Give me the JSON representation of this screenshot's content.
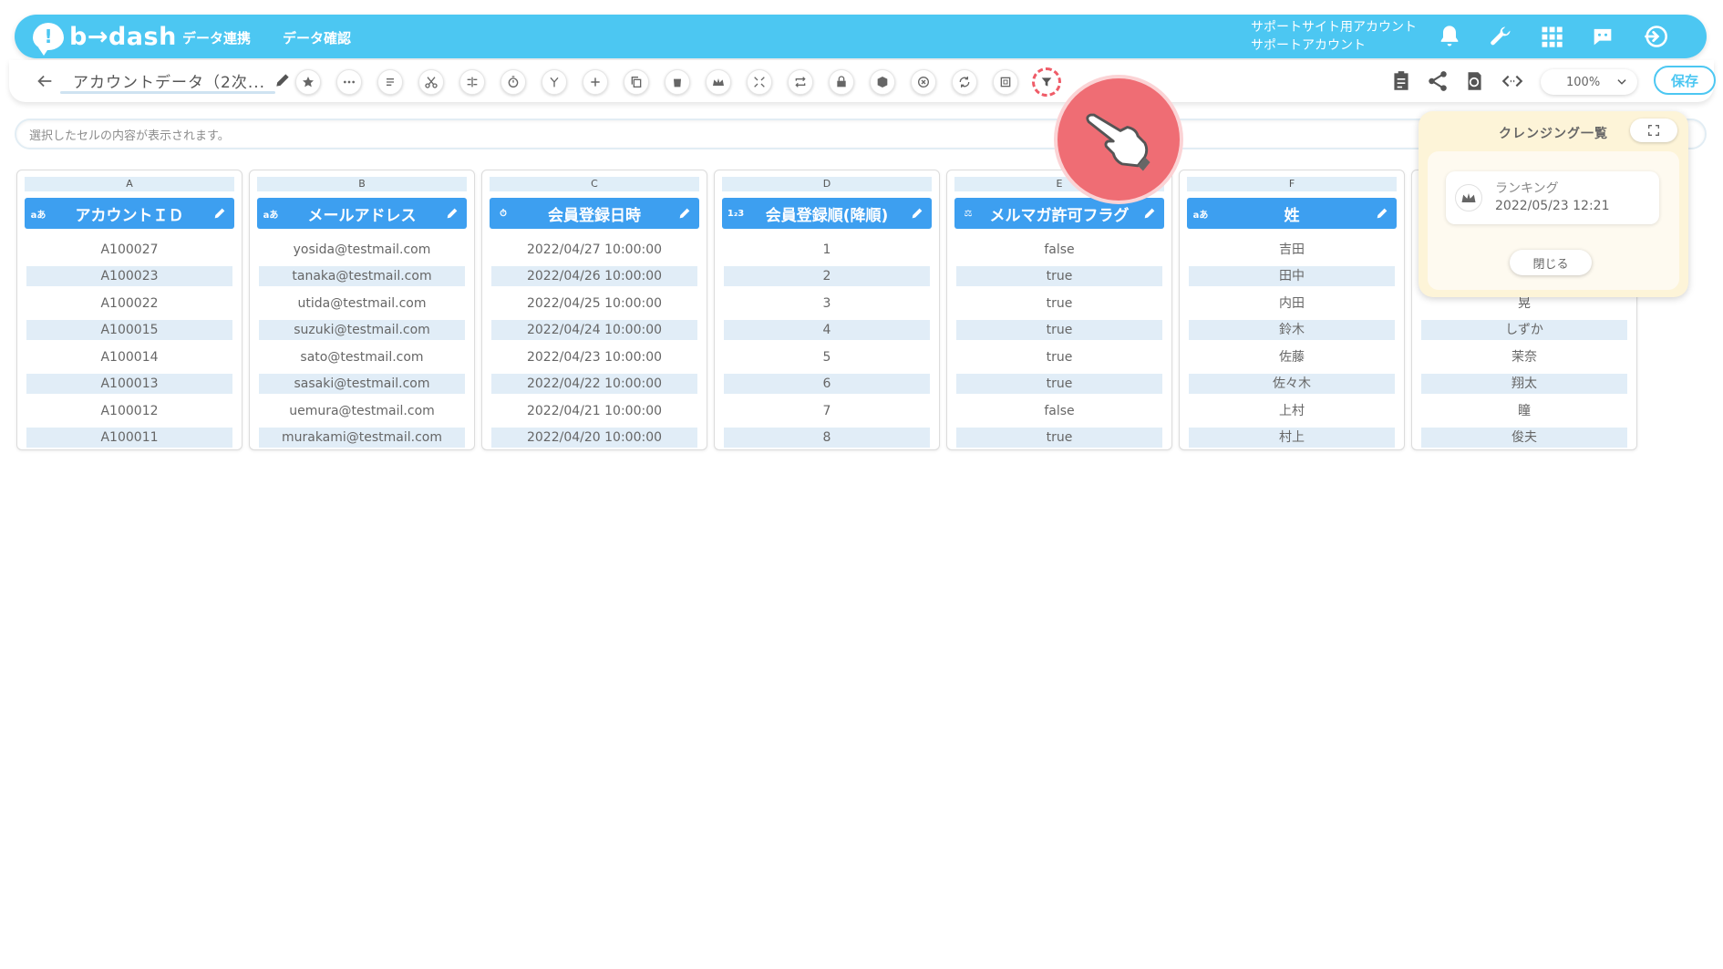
{
  "header": {
    "logo_text": "b→dash",
    "nav": [
      "データ連携",
      "データ確認"
    ],
    "account_line1": "サポートサイト用アカウント",
    "account_line2": "サポートアカウント"
  },
  "toolbar": {
    "title": "アカウントデータ（2次...",
    "zoom": "100%",
    "save_label": "保存",
    "tools": [
      "star-icon",
      "more-icon",
      "list-icon",
      "scissors-icon",
      "split-icon",
      "timer-icon",
      "branch-icon",
      "plus-icon",
      "copy-icon",
      "trash-icon",
      "crown-icon",
      "compress-icon",
      "repeat-icon",
      "lock-icon",
      "cube-icon",
      "close-circle-icon",
      "refresh-icon",
      "frame-icon",
      "filter-icon"
    ]
  },
  "formula_bar": {
    "placeholder": "選択したセルの内容が表示されます。"
  },
  "grid": {
    "columns": [
      {
        "letter": "A",
        "name": "アカウントＩＤ",
        "type": "text",
        "cells": [
          "A100027",
          "A100023",
          "A100022",
          "A100015",
          "A100014",
          "A100013",
          "A100012",
          "A100011"
        ]
      },
      {
        "letter": "B",
        "name": "メールアドレス",
        "type": "text",
        "cells": [
          "yosida@testmail.com",
          "tanaka@testmail.com",
          "utida@testmail.com",
          "suzuki@testmail.com",
          "sato@testmail.com",
          "sasaki@testmail.com",
          "uemura@testmail.com",
          "murakami@testmail.com"
        ]
      },
      {
        "letter": "C",
        "name": "会員登録日時",
        "type": "datetime",
        "cells": [
          "2022/04/27 10:00:00",
          "2022/04/26 10:00:00",
          "2022/04/25 10:00:00",
          "2022/04/24 10:00:00",
          "2022/04/23 10:00:00",
          "2022/04/22 10:00:00",
          "2022/04/21 10:00:00",
          "2022/04/20 10:00:00"
        ]
      },
      {
        "letter": "D",
        "name": "会員登録順(降順)",
        "type": "number",
        "cells": [
          "1",
          "2",
          "3",
          "4",
          "5",
          "6",
          "7",
          "8"
        ]
      },
      {
        "letter": "E",
        "name": "メルマガ許可フラグ",
        "type": "boolean",
        "cells": [
          "false",
          "true",
          "true",
          "true",
          "true",
          "true",
          "false",
          "true"
        ]
      },
      {
        "letter": "F",
        "name": "姓",
        "type": "text",
        "cells": [
          "吉田",
          "田中",
          "内田",
          "鈴木",
          "佐藤",
          "佐々木",
          "上村",
          "村上"
        ]
      },
      {
        "letter": "",
        "name": "",
        "type": "text",
        "cells": [
          "",
          "",
          "晃",
          "しずか",
          "茉奈",
          "翔太",
          "瞳",
          "俊夫"
        ]
      }
    ]
  },
  "cleansing_panel": {
    "title": "クレンジング一覧",
    "item_name": "ランキング",
    "item_date": "2022/05/23 12:21",
    "close_label": "閉じる"
  },
  "colors": {
    "brand": "#4cc7f2",
    "header_col": "#3d9ff0",
    "row_alt": "#e1edf7",
    "highlight": "#ef5c68"
  }
}
